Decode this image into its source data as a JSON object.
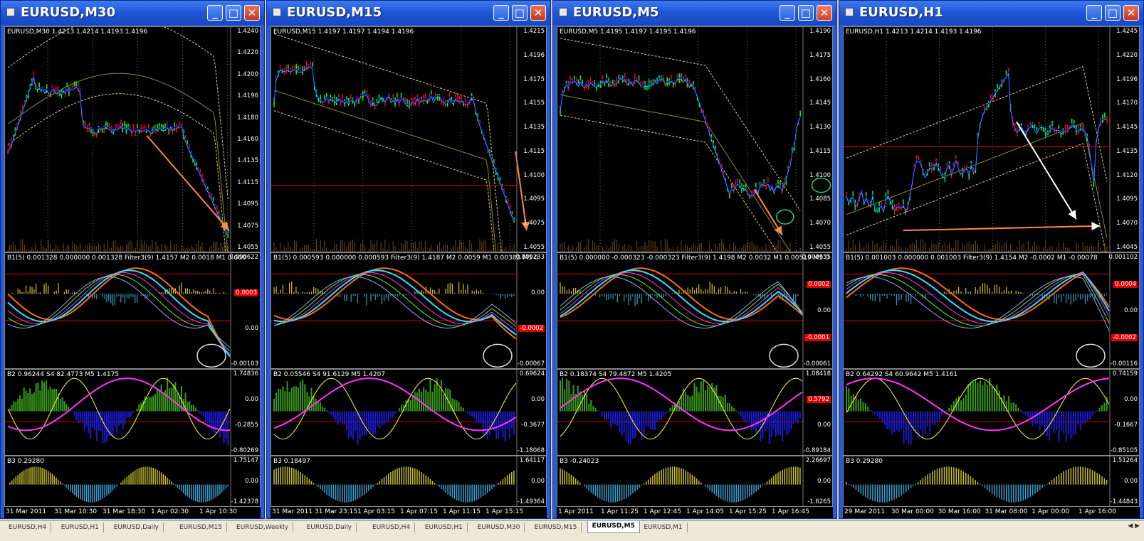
{
  "windows": [
    {
      "title": "EURUSD,M30",
      "price_label": "EURUSD,M30  1.4213 1.4214 1.4193 1.4196",
      "price_ticks": [
        "1.4240",
        "1.4220",
        "1.4200",
        "1.4196",
        "1.4180",
        "1.4160",
        "1.4135",
        "1.4115",
        "1.4095",
        "1.4075",
        "1.4055"
      ],
      "b1_label": "B1(5) 0.001328 0.000000 0.001328  Filter3(9) 1.4157  M2 0.0018  M1 0.000",
      "b1_ticks": [
        "0.000622",
        "0.0003",
        "0.00",
        "-0.00103"
      ],
      "b2_label": "B2 0.96244  S4 82.4773  M5 1.4175",
      "b2_ticks": [
        "1.74836",
        "0.00",
        "-0.2855",
        "-0.80269"
      ],
      "b3_label": "B3 0.29280",
      "b3_ticks": [
        "1.75147",
        "0.00",
        "-1.42378"
      ],
      "times": [
        "31 Mar 2011",
        "31 Mar 10:30",
        "31 Mar 18:30",
        "1 Apr 02:30",
        "1 Apr 10:30"
      ]
    },
    {
      "title": "EURUSD,M15",
      "price_label": "EURUSD,M15  1.4197 1.4197 1.4194 1.4196",
      "price_ticks": [
        "1.4215",
        "1.4196",
        "1.4175",
        "1.4155",
        "1.4135",
        "1.4115",
        "1.4100",
        "1.4095",
        "1.4075",
        "1.4055"
      ],
      "b1_label": "B1(5) 0.000593 0.000000 0.000593  Filter3(9) 1.4187  M2 0.0059  M1 0.00383  M3 0",
      "b1_ticks": [
        "0.000233",
        "0.00",
        "-0.0002",
        "-0.00067"
      ],
      "b2_label": "B2 0.05546  S4 91.6129  M5 1.4207",
      "b2_ticks": [
        "0.69624",
        "0.00",
        "-0.3677",
        "-1.18068"
      ],
      "b3_label": "B3 0.18497",
      "b3_ticks": [
        "1.64117",
        "0.00",
        "-1.49364"
      ],
      "times": [
        "31 Mar 2011",
        "31 Mar 23:15",
        "1 Apr 03:15",
        "1 Apr 07:15",
        "1 Apr 11:15",
        "1 Apr 15:15"
      ]
    },
    {
      "title": "EURUSD,M5",
      "price_label": "EURUSD,M5  1.4195 1.4197 1.4195 1.4196",
      "price_ticks": [
        "1.4190",
        "1.4175",
        "1.4160",
        "1.4145",
        "1.4130",
        "1.4115",
        "1.4100",
        "1.4085",
        "1.4070",
        "1.4055"
      ],
      "b1_label": "B1(5) 0.000000 -0.000323 -0.000323  Filter3(9) 1.4198  M2 0.0032  M1 0.00519  M3 0",
      "b1_ticks": [
        "0.000655",
        "0.0002",
        "0.00",
        "-0.0001",
        "-0.00061"
      ],
      "b2_label": "B2 0.18374  S4 79.4872  M5 1.4205",
      "b2_ticks": [
        "1.08418",
        "0.5792",
        "0.00",
        "-0.89184"
      ],
      "b3_label": "B3 -0.24023",
      "b3_ticks": [
        "2.26697",
        "0.00",
        "-1.6265"
      ],
      "times": [
        "1 Apr 2011",
        "1 Apr 11:25",
        "1 Apr 12:45",
        "1 Apr 14:05",
        "1 Apr 15:25",
        "1 Apr 16:45"
      ]
    },
    {
      "title": "EURUSD,H1",
      "price_label": "EURUSD,H1  1.4213 1.4214 1.4193 1.4196",
      "price_ticks": [
        "1.4245",
        "1.4220",
        "1.4196",
        "1.4170",
        "1.4145",
        "1.4135",
        "1.4120",
        "1.4095",
        "1.4070",
        "1.4045"
      ],
      "b1_label": "B1(5) 0.001003 0.000000 0.001003  Filter3(9) 1.4154  M2 -0.0002  M1 -0.00078",
      "b1_ticks": [
        "0.001102",
        "0.0004",
        "0.00",
        "-0.0002",
        "-0.00116"
      ],
      "b2_label": "B2 0.64292  S4 60.9642  M5 1.4161",
      "b2_ticks": [
        "0.74159",
        "0.00",
        "-0.1667",
        "-0.85105"
      ],
      "b3_label": "B3 0.29280",
      "b3_ticks": [
        "1.51264",
        "0.00",
        "-1.44843"
      ],
      "times": [
        "29 Mar 2011",
        "30 Mar 00:00",
        "30 Mar 16:00",
        "31 Mar 08:00",
        "1 Apr 00:00",
        "1 Apr 16:00"
      ]
    }
  ],
  "tabs": [
    "EURUSD,H4",
    "EURUSD,H1",
    "EURUSD,Daily",
    "EURUSD,M15",
    "EURUSD,Weekly",
    "EURUSD,Daily",
    "EURUSD,H4",
    "EURUSD,H1",
    "EURUSD,M30",
    "EURUSD,M15",
    "EURUSD,M5",
    "EURUSD,M1"
  ],
  "active_tab_index": 10,
  "colors": {
    "candle_up": "#00ff00",
    "candle_down": "#ff0000",
    "line_blue": "#0000ff",
    "cyan": "#33e0ff",
    "magenta": "#ff33ff",
    "orange": "#ff6a10",
    "yellow": "#ffff40",
    "green_hist": "#3a9a1a",
    "blue_hist": "#1a1acc",
    "level_red": "#e00000",
    "arrow": "#ff8844"
  },
  "icons": {
    "window_icon": "chart-window-icon",
    "minimize": "minimize-icon",
    "maximize": "maximize-icon",
    "close": "close-icon"
  }
}
